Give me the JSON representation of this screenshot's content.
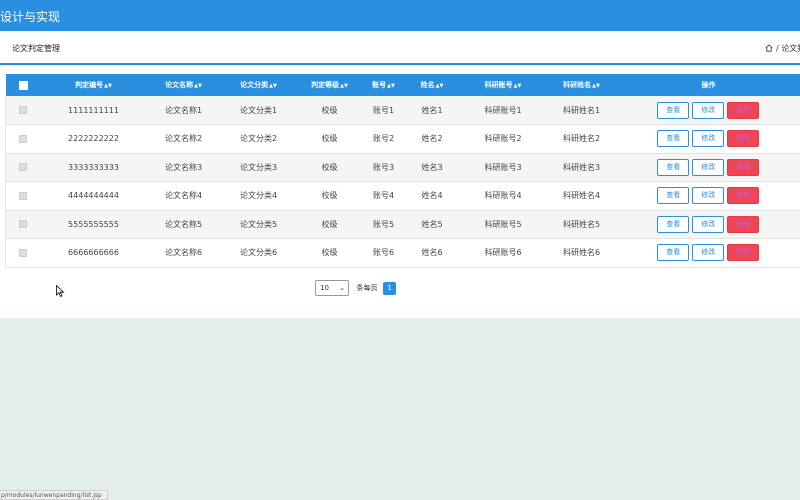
{
  "app": {
    "title": "设计与实现"
  },
  "header": {
    "page_title": "论文判定管理",
    "breadcrumb": "/ 论文判"
  },
  "table": {
    "columns": [
      "判定编号",
      "论文名称",
      "论文分类",
      "判定等级",
      "账号",
      "姓名",
      "科研账号",
      "科研姓名",
      "操作"
    ],
    "rows": [
      [
        "1111111111",
        "论文名称1",
        "论文分类1",
        "校级",
        "账号1",
        "姓名1",
        "科研账号1",
        "科研姓名1"
      ],
      [
        "2222222222",
        "论文名称2",
        "论文分类2",
        "校级",
        "账号2",
        "姓名2",
        "科研账号2",
        "科研姓名2"
      ],
      [
        "3333333333",
        "论文名称3",
        "论文分类3",
        "校级",
        "账号3",
        "姓名3",
        "科研账号3",
        "科研姓名3"
      ],
      [
        "4444444444",
        "论文名称4",
        "论文分类4",
        "校级",
        "账号4",
        "姓名4",
        "科研账号4",
        "科研姓名4"
      ],
      [
        "5555555555",
        "论文名称5",
        "论文分类5",
        "校级",
        "账号5",
        "姓名5",
        "科研账号5",
        "科研姓名5"
      ],
      [
        "6666666666",
        "论文名称6",
        "论文分类6",
        "校级",
        "账号6",
        "姓名6",
        "科研账号6",
        "科研姓名6"
      ]
    ],
    "actions": {
      "view": "查看",
      "edit": "修改",
      "delete": "删除"
    }
  },
  "pagination": {
    "page_size": "10",
    "per_page_label": "条每页",
    "current_page": "1"
  },
  "status_bar": {
    "url": "p/modules/lunwenpanding/list.jsp"
  },
  "colors": {
    "primary": "#2b8fe0",
    "danger": "#ef4555",
    "page_background": "#e4efe9"
  }
}
